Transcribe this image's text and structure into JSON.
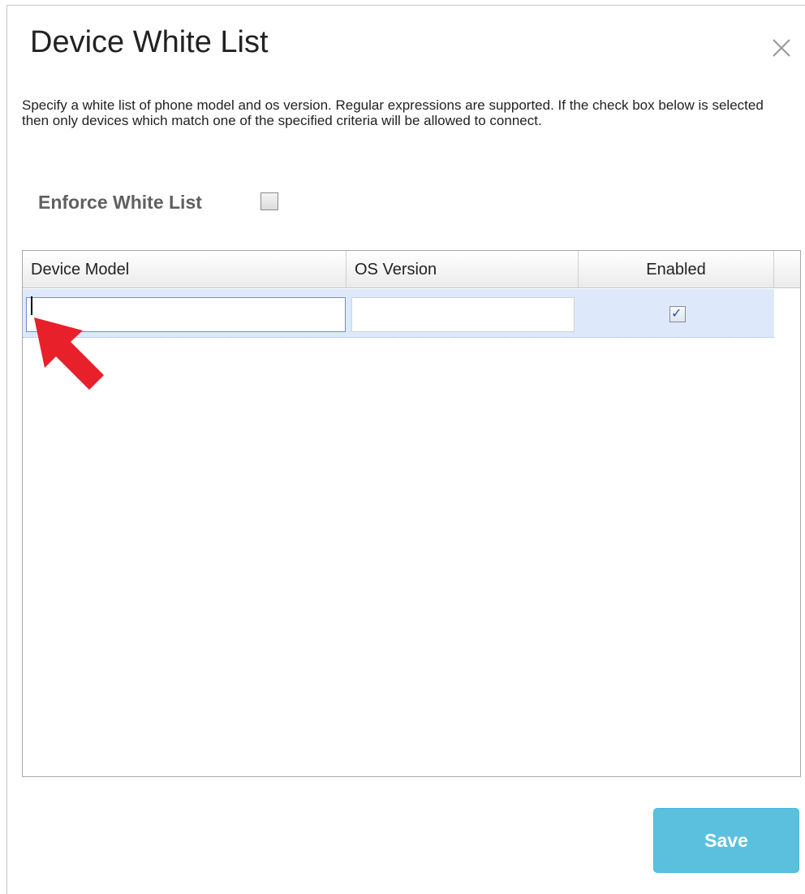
{
  "dialog": {
    "title": "Device White List",
    "close_icon": "close-icon",
    "description": "Specify a white list of phone model and os version. Regular expressions are supported. If the check box below is selected then only devices which match one of the specified criteria will be allowed to connect.",
    "enforce_label": "Enforce White List",
    "enforce_checked": false
  },
  "grid": {
    "columns": [
      "Device Model",
      "OS Version",
      "Enabled"
    ],
    "rows": [
      {
        "device_model": "",
        "os_version": "",
        "enabled": true
      }
    ]
  },
  "annotation": {
    "icon": "red-arrow-icon",
    "color": "#e8202a"
  },
  "footer": {
    "save_label": "Save",
    "save_color": "#5bc0de"
  }
}
